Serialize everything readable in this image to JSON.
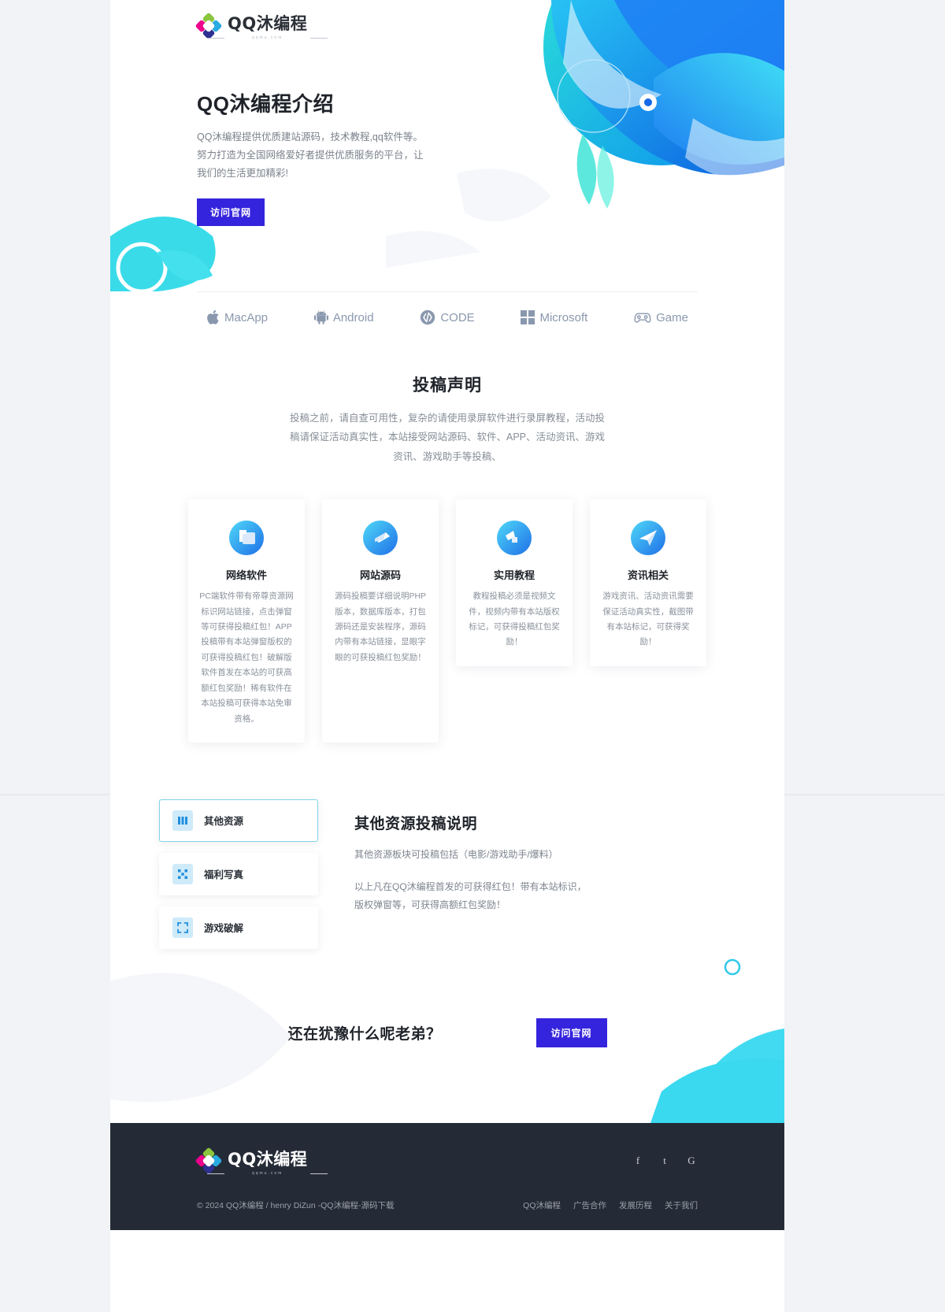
{
  "brand": {
    "logo_title": "QQ沐编程",
    "logo_sub": "qqmu.com",
    "accent_blue": "#3524dd",
    "accent_cyan": "#2ad2e8",
    "footer_bg": "#252b36"
  },
  "hero": {
    "title": "QQ沐编程介绍",
    "paragraph": "QQ沐编程提供优质建站源码，技术教程,qq软件等。努力打造为全国网络爱好者提供优质服务的平台，让我们的生活更加精彩!",
    "button": "访问官网"
  },
  "brands": [
    {
      "name": "MacApp",
      "icon": "apple-icon"
    },
    {
      "name": "Android",
      "icon": "android-icon"
    },
    {
      "name": "CODE",
      "icon": "code-icon"
    },
    {
      "name": "Microsoft",
      "icon": "microsoft-icon"
    },
    {
      "name": "Game",
      "icon": "gamepad-icon"
    }
  ],
  "statement": {
    "title": "投稿声明",
    "description": "投稿之前，请自查可用性，复杂的请使用录屏软件进行录屏教程，活动投稿请保证活动真实性，本站接受网站源码、软件、APP、活动资讯、游戏资讯、游戏助手等投稿、"
  },
  "cards": [
    {
      "title": "网络软件",
      "text": "PC端软件带有帝尊资源网标识网站链接，点击弹窗等可获得投稿红包！APP投稿带有本站弹窗版权的可获得投稿红包！破解版软件首发在本站的可获高额红包奖励！稀有软件在本站投稿可获得本站免审资格。",
      "icon": "network-software-icon"
    },
    {
      "title": "网站源码",
      "text": "源码投稿要详细说明PHP版本，数据库版本，打包源码还是安装程序，源码内带有本站链接，显眼字眼的可获投稿红包奖励！",
      "icon": "source-code-icon"
    },
    {
      "title": "实用教程",
      "text": "教程投稿必须是视频文件，视频内带有本站版权标记，可获得投稿红包奖励！",
      "icon": "tutorial-icon"
    },
    {
      "title": "资讯相关",
      "text": "游戏资讯、活动资讯需要保证活动真实性，截图带有本站标记，可获得奖励！",
      "icon": "news-icon"
    }
  ],
  "tabs": {
    "items": [
      {
        "label": "其他资源",
        "icon": "bars-icon",
        "active": true
      },
      {
        "label": "福利写真",
        "icon": "scatter-icon",
        "active": false
      },
      {
        "label": "游戏破解",
        "icon": "expand-icon",
        "active": false
      }
    ],
    "panel": {
      "title": "其他资源投稿说明",
      "paragraph1": "其他资源板块可投稿包括（电影/游戏助手/爆料）",
      "paragraph2": "以上凡在QQ沐编程首发的可获得红包！带有本站标识，版权弹窗等，可获得高额红包奖励！"
    }
  },
  "cta": {
    "title": "还在犹豫什么呢老弟？",
    "button": "访问官网"
  },
  "footer": {
    "logo_title": "QQ沐编程",
    "logo_sub": "qqmu.com",
    "copyright": "© 2024 QQ沐编程 / henry DiZun -QQ沐编程-源码下载",
    "socials": [
      {
        "name": "facebook-icon",
        "glyph": "f"
      },
      {
        "name": "twitter-icon",
        "glyph": "t"
      },
      {
        "name": "google-icon",
        "glyph": "G"
      }
    ],
    "links": [
      "QQ沐编程",
      "广告合作",
      "发展历程",
      "关于我们"
    ]
  }
}
